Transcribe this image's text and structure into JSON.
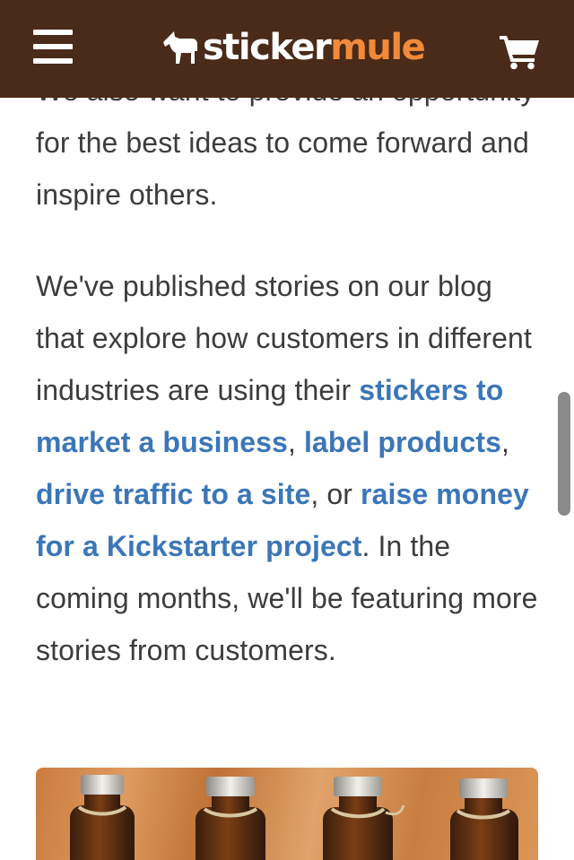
{
  "header": {
    "logo_sticker": "sticker",
    "logo_mule": "mule",
    "colors": {
      "background": "#4a2a19",
      "logo_accent": "#f28a39",
      "link": "#3b76b8"
    },
    "icons": {
      "menu": "hamburger-menu-icon",
      "logo": "mule-logo-icon",
      "cart": "shopping-cart-icon"
    }
  },
  "article": {
    "para1_line0": "We also want to provide an",
    "para1_rest": "opportunity for the best ideas to come forward and inspire others.",
    "p2_before": "We've published stories on our blog that explore how customers in different industries are using their ",
    "link1": "stickers to market a business",
    "sep1": ", ",
    "link2": "label products",
    "sep2": ", ",
    "link3": "drive traffic to a site",
    "sep3": ", or ",
    "link4": "raise money for a Kickstarter project",
    "p2_after": ". In the coming months, we'll be featuring more stories from customers."
  },
  "media": {
    "photo_subject": "bottles with rope tied around necks"
  }
}
